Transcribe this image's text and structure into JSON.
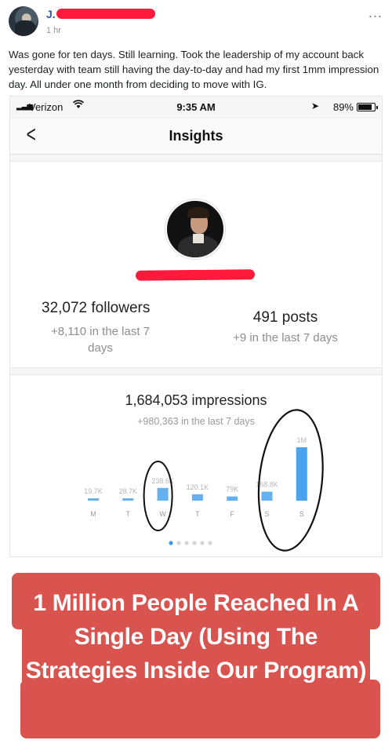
{
  "post": {
    "author_initial": "J.",
    "time": "1 hr",
    "more": "...",
    "text": "Was gone for ten days. Still learning. Took the leadership of my account back yesterday with team still having the day-to-day and had my first 1mm impression day. All under one month from deciding to move with IG."
  },
  "phone": {
    "carrier": "Verizon",
    "time": "9:35 AM",
    "battery": "89%",
    "nav_title": "Insights",
    "back": "<"
  },
  "insights": {
    "followers": "32,072 followers",
    "followers_delta": "+8,110 in the last 7 days",
    "posts": "491 posts",
    "posts_delta": "+9 in the last 7 days",
    "impressions": "1,684,053 impressions",
    "impressions_delta": "+980,363 in the last 7 days"
  },
  "chart_data": {
    "type": "bar",
    "categories": [
      "M",
      "T",
      "W",
      "T",
      "F",
      "S",
      "S"
    ],
    "value_labels": [
      "19.7K",
      "28.7K",
      "238.6K",
      "120.1K",
      "79K",
      "168.8K",
      "1M"
    ],
    "values": [
      19700,
      28700,
      238600,
      120100,
      79000,
      168800,
      1000000
    ],
    "bar_color": "#4aa3ec",
    "annotation_color": "#111111"
  },
  "promo": {
    "text": "1 Million People Reached In A Single Day (Using The Strategies Inside Our Program)",
    "background": "#d9534f"
  }
}
